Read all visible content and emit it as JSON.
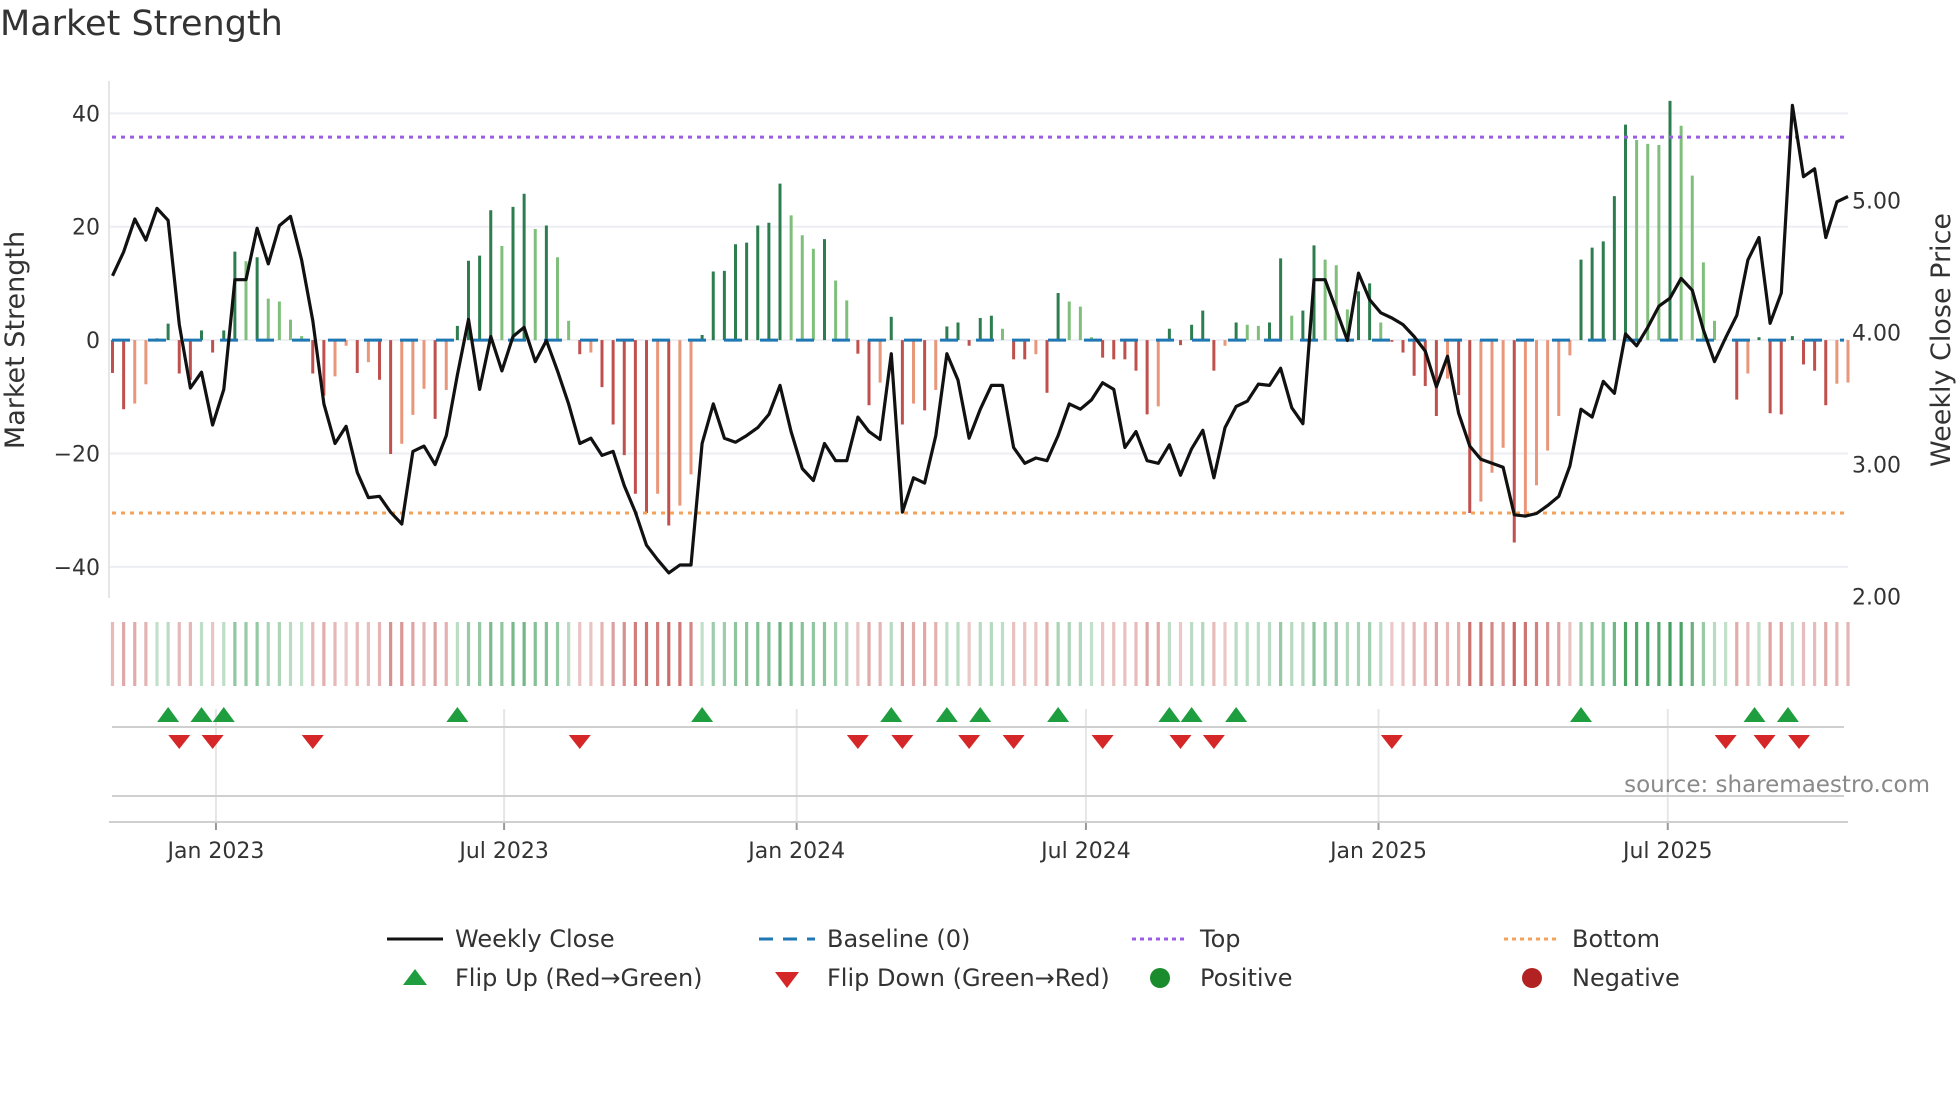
{
  "title": "Market Strength",
  "colors": {
    "close": "#111111",
    "baseline": "#1f77b4",
    "top": "#9b5de5",
    "bottom": "#f4a259",
    "pos_dark": "#2e7d4f",
    "pos_light": "#7fbf7b",
    "neg_dark": "#c0504d",
    "neg_light": "#e9967a",
    "flip_up": "#1e9e3e",
    "flip_down": "#d62728",
    "positive": "#1a8c2e",
    "negative": "#b22222",
    "grid": "#eceef3"
  },
  "source": "source: sharemaestro.com",
  "legend": [
    {
      "label": "Weekly Close",
      "symbol": "line"
    },
    {
      "label": "Baseline (0)",
      "symbol": "dashed"
    },
    {
      "label": "Top",
      "symbol": "dotted-top"
    },
    {
      "label": "Bottom",
      "symbol": "dotted-bottom"
    },
    {
      "label": "Flip Up (Red→Green)",
      "symbol": "triangle-up"
    },
    {
      "label": "Flip Down (Green→Red)",
      "symbol": "triangle-down"
    },
    {
      "label": "Positive",
      "symbol": "circle-pos"
    },
    {
      "label": "Negative",
      "symbol": "circle-neg"
    }
  ],
  "chart_data": {
    "type": "bar+line",
    "title": "Market Strength",
    "ylabel": "Market Strength",
    "y2label": "Weekly Close Price",
    "ylim": [
      -45.5,
      45.7
    ],
    "y2lim": [
      1.99,
      5.905
    ],
    "yticks": [
      {
        "v": 40,
        "label": "40"
      },
      {
        "v": 20,
        "label": "20"
      },
      {
        "v": 0,
        "label": "0"
      },
      {
        "v": -20,
        "label": "−20"
      },
      {
        "v": -40,
        "label": "−40"
      }
    ],
    "y2ticks": [
      {
        "v": 5,
        "label": "5.00"
      },
      {
        "v": 4,
        "label": "4.00"
      },
      {
        "v": 3,
        "label": "3.00"
      },
      {
        "v": 2,
        "label": "2.00"
      }
    ],
    "xticks": [
      {
        "week": 9.3,
        "label": "Jan 2023"
      },
      {
        "week": 35.2,
        "label": "Jul 2023"
      },
      {
        "week": 61.5,
        "label": "Jan 2024"
      },
      {
        "week": 87.5,
        "label": "Jul 2024"
      },
      {
        "week": 113.8,
        "label": "Jan 2025"
      },
      {
        "week": 139.8,
        "label": "Jul 2025"
      }
    ],
    "top_level": 35.8,
    "bottom_level": -30.5,
    "baseline": 0,
    "strength": [
      -5.8,
      -12.2,
      -11.2,
      -7.8,
      0.3,
      2.9,
      -5.9,
      -7,
      1.7,
      -2.2,
      1.7,
      15.6,
      13.9,
      14.6,
      7.3,
      6.8,
      3.6,
      0.7,
      -5.9,
      -9.8,
      -6.4,
      -1.0,
      -5.8,
      -3.9,
      -7.0,
      -20.1,
      -18.3,
      -13.2,
      -8.6,
      -13.9,
      -8.8,
      2.5,
      14.0,
      14.9,
      22.9,
      16.6,
      23.5,
      25.8,
      19.6,
      20.2,
      14.6,
      3.4,
      -2.5,
      -2.2,
      -8.3,
      -14.9,
      -20.3,
      -27.1,
      -30.5,
      -27.1,
      -32.7,
      -29.2,
      -23.7,
      0.9,
      12.1,
      12.2,
      16.9,
      17.2,
      20.2,
      20.7,
      27.6,
      22.0,
      18.5,
      16.1,
      17.8,
      10.5,
      7.0,
      -2.4,
      -11.5,
      -7.5,
      4.1,
      -14.9,
      -11.2,
      -12.4,
      -8.8,
      2.4,
      3.1,
      -1.0,
      3.9,
      4.3,
      2.0,
      -3.4,
      -3.4,
      -2.5,
      -9.3,
      8.3,
      6.8,
      5.9,
      0.5,
      -3.1,
      -3.4,
      -3.4,
      -5.4,
      -13.1,
      -11.7,
      2.0,
      -0.9,
      2.7,
      5.2,
      -5.4,
      -1.0,
      3.1,
      2.7,
      2.5,
      3.1,
      14.4,
      4.3,
      5.2,
      16.7,
      14.2,
      13.2,
      5.4,
      8.6,
      10.0,
      3.1,
      -0.3,
      -2.2,
      -6.3,
      -8.1,
      -13.4,
      -6.8,
      -9.7,
      -30.5,
      -28.5,
      -23.4,
      -19.0,
      -35.7,
      -30.8,
      -25.6,
      -19.5,
      -13.4,
      -2.7,
      14.2,
      16.3,
      17.4,
      25.4,
      38.0,
      35.3,
      34.6,
      34.4,
      42.2,
      37.8,
      29.0,
      13.7,
      3.4,
      0.3,
      -10.5,
      -5.9,
      0.5,
      -12.9,
      -13.1,
      0.7,
      -4.3,
      -5.4,
      -11.5,
      -7.7,
      -7.5
    ],
    "close": [
      4.43,
      4.61,
      4.86,
      4.7,
      4.94,
      4.85,
      4.06,
      3.58,
      3.7,
      3.3,
      3.57,
      4.4,
      4.4,
      4.79,
      4.52,
      4.81,
      4.88,
      4.55,
      4.09,
      3.46,
      3.16,
      3.29,
      2.94,
      2.75,
      2.76,
      2.64,
      2.55,
      3.1,
      3.14,
      3.0,
      3.22,
      3.68,
      4.1,
      3.57,
      3.97,
      3.71,
      3.97,
      4.04,
      3.78,
      3.94,
      3.71,
      3.46,
      3.16,
      3.2,
      3.07,
      3.1,
      2.84,
      2.64,
      2.39,
      2.28,
      2.18,
      2.24,
      2.24,
      3.16,
      3.46,
      3.2,
      3.17,
      3.22,
      3.28,
      3.38,
      3.6,
      3.25,
      2.97,
      2.88,
      3.16,
      3.03,
      3.03,
      3.36,
      3.25,
      3.19,
      3.84,
      2.64,
      2.9,
      2.86,
      3.22,
      3.84,
      3.64,
      3.2,
      3.42,
      3.6,
      3.6,
      3.13,
      3.01,
      3.05,
      3.03,
      3.22,
      3.46,
      3.42,
      3.49,
      3.62,
      3.57,
      3.13,
      3.25,
      3.03,
      3.01,
      3.15,
      2.92,
      3.12,
      3.26,
      2.9,
      3.28,
      3.44,
      3.48,
      3.61,
      3.6,
      3.73,
      3.43,
      3.31,
      4.4,
      4.4,
      4.17,
      3.94,
      4.45,
      4.25,
      4.15,
      4.11,
      4.06,
      3.97,
      3.86,
      3.59,
      3.82,
      3.39,
      3.14,
      3.04,
      3.01,
      2.98,
      2.62,
      2.61,
      2.63,
      2.69,
      2.76,
      2.99,
      3.42,
      3.36,
      3.63,
      3.54,
      3.99,
      3.9,
      4.04,
      4.2,
      4.26,
      4.41,
      4.32,
      4.02,
      3.78,
      3.96,
      4.13,
      4.55,
      4.72,
      4.07,
      4.3,
      5.72,
      5.18,
      5.24,
      4.72,
      4.99,
      5.03
    ],
    "flip_up_weeks": [
      5,
      8,
      10,
      31,
      53,
      70,
      75,
      78,
      85,
      95,
      97,
      101,
      132,
      147.6,
      150.6
    ],
    "flip_down_weeks": [
      6,
      9,
      18,
      42,
      67,
      71,
      77,
      81,
      89,
      96,
      99,
      115,
      145,
      148.5,
      151.6
    ]
  }
}
